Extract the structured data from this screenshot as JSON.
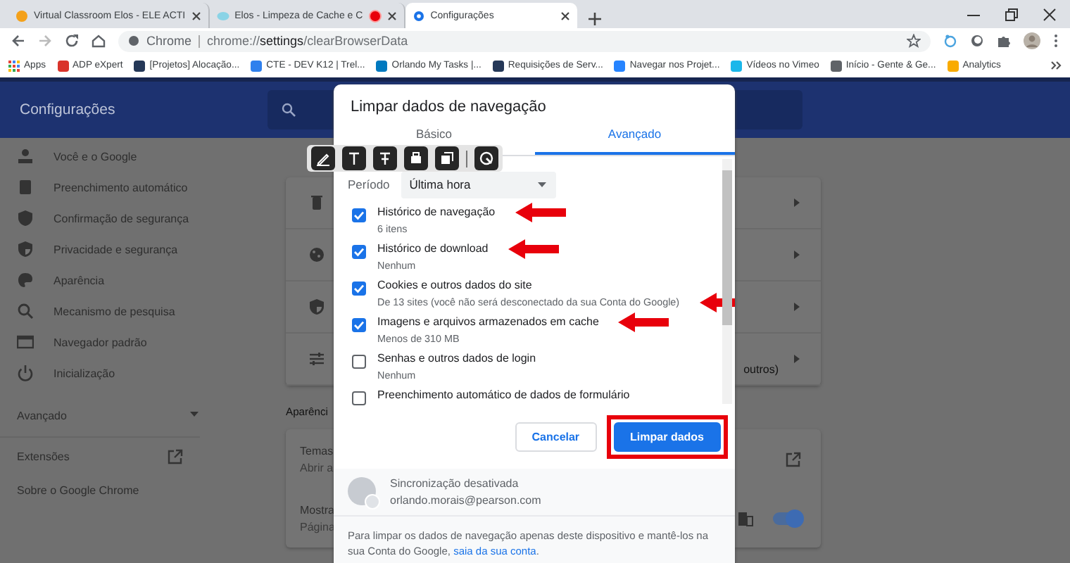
{
  "browser": {
    "tabs": [
      {
        "title": "Virtual Classroom Elos - ELE ACTI",
        "selected": false,
        "recording": false
      },
      {
        "title": "Elos - Limpeza de Cache e C",
        "selected": false,
        "recording": true
      },
      {
        "title": "Configurações",
        "selected": true,
        "recording": false
      }
    ],
    "address": {
      "scheme_label": "Chrome",
      "url": "chrome://**settings**/clearBrowserData"
    },
    "apps_label": "Apps",
    "bookmarks": [
      {
        "title": "ADP eXpert",
        "color": "#d9342b"
      },
      {
        "title": "[Projetos] Alocação...",
        "color": "#253858"
      },
      {
        "title": "CTE - DEV K12 | Trel...",
        "color": "#2f80ed"
      },
      {
        "title": "Orlando My Tasks |...",
        "color": "#0079bf"
      },
      {
        "title": "Requisições de Serv...",
        "color": "#253858"
      },
      {
        "title": "Navegar nos Projet...",
        "color": "#2684ff"
      },
      {
        "title": "Vídeos no Vimeo",
        "color": "#1ab7ea"
      },
      {
        "title": "Início - Gente & Ge...",
        "color": "#5f6368"
      },
      {
        "title": "Analytics",
        "color": "#f9ab00"
      }
    ]
  },
  "settings": {
    "title": "Configurações",
    "nav": [
      {
        "label": "Você e o Google"
      },
      {
        "label": "Preenchimento automático"
      },
      {
        "label": "Confirmação de segurança"
      },
      {
        "label": "Privacidade e segurança"
      },
      {
        "label": "Aparência"
      },
      {
        "label": "Mecanismo de pesquisa"
      },
      {
        "label": "Navegador padrão"
      },
      {
        "label": "Inicialização"
      }
    ],
    "advanced": {
      "label": "Avançado",
      "expanded": false
    },
    "footer_links": [
      {
        "label": "Extensões",
        "external": true
      },
      {
        "label": "Sobre o Google Chrome",
        "external": false
      }
    ],
    "privacy_last_row_tail": "outros)",
    "appearance": {
      "heading": "Aparênci",
      "rows": [
        {
          "kind": "link",
          "title": "Temas",
          "detail": "Abrir a"
        },
        {
          "kind": "toggle",
          "title": "Mostra",
          "detail": "Página",
          "on": true
        }
      ]
    }
  },
  "dialog": {
    "title": "Limpar dados de navegação",
    "tabs": [
      {
        "label": "Básico",
        "selected": false
      },
      {
        "label": "Avançado",
        "selected": true
      }
    ],
    "period": {
      "label": "Período",
      "value": "Última hora"
    },
    "items": [
      {
        "label": "Histórico de navegação",
        "detail": "6 itens",
        "checked": true,
        "label_arrow": true,
        "detail_arrow": false
      },
      {
        "label": "Histórico de download",
        "detail": "Nenhum",
        "checked": true,
        "label_arrow": true,
        "detail_arrow": false
      },
      {
        "label": "Cookies e outros dados do site",
        "detail": "De 13 sites (você não será desconectado da sua Conta do Google)",
        "checked": true,
        "label_arrow": false,
        "detail_arrow": true
      },
      {
        "label": "Imagens e arquivos armazenados em cache",
        "detail": "Menos de 310 MB",
        "checked": true,
        "label_arrow": true,
        "detail_arrow": false
      },
      {
        "label": "Senhas e outros dados de login",
        "detail": "Nenhum",
        "checked": false,
        "label_arrow": false,
        "detail_arrow": false
      },
      {
        "label": "Preenchimento automático de dados de formulário",
        "checked": false,
        "label_arrow": false
      }
    ],
    "buttons": [
      {
        "label": "Cancelar",
        "kind": "secondary",
        "highlighted": false
      },
      {
        "label": "Limpar dados",
        "kind": "primary",
        "highlighted": true
      }
    ],
    "sync": {
      "status": "Sincronização desativada",
      "email": "orlando.morais@pearson.com"
    },
    "note": "Para limpar os dados de navegação apenas deste dispositivo e mantê-los na sua Conta do Google,",
    "note_link": "saia da sua conta",
    "note_end": "."
  }
}
